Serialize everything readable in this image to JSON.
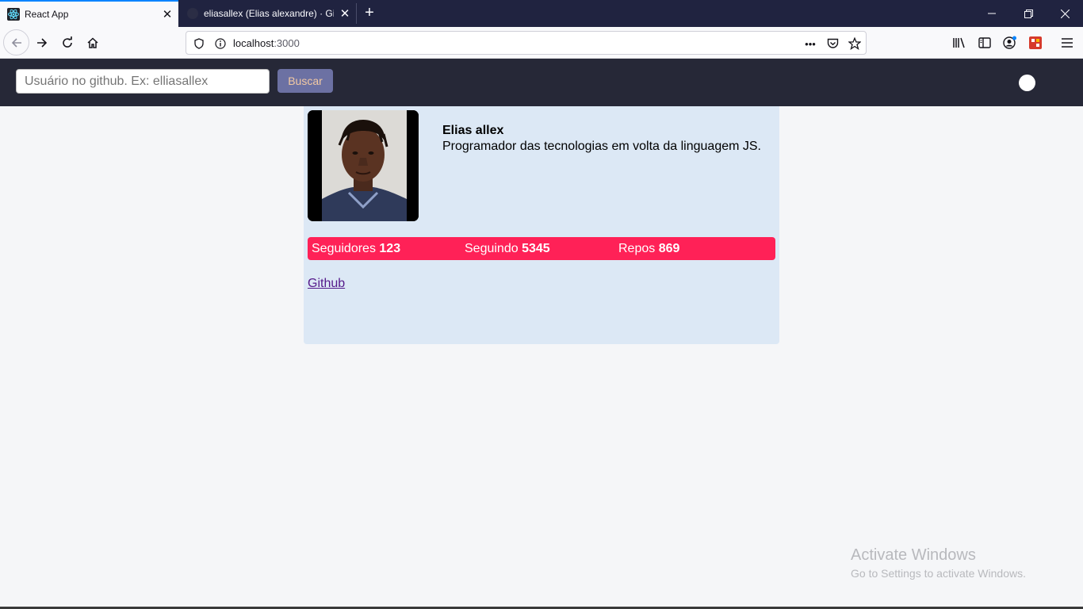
{
  "browser": {
    "tabs": [
      {
        "title": "React App",
        "active": true,
        "icon": "react-icon"
      },
      {
        "title": "eliasallex (Elias alexandre) · GitHub",
        "active": false,
        "icon": "github-icon"
      }
    ],
    "url_host": "localhost",
    "url_port": ":3000"
  },
  "search": {
    "placeholder": "Usuário no github. Ex: elliasallex",
    "value": "",
    "button_label": "Buscar"
  },
  "profile": {
    "name": "Elias allex",
    "bio": "Programador das tecnologias em volta da linguagem JS.",
    "stats": [
      {
        "label": "Seguidores",
        "value": "123"
      },
      {
        "label": "Seguindo",
        "value": "5345"
      },
      {
        "label": "Repos",
        "value": "869"
      }
    ],
    "link_label": "Github"
  },
  "watermark": {
    "line1": "Activate Windows",
    "line2": "Go to Settings to activate Windows."
  },
  "colors": {
    "header_bg": "#262837",
    "card_bg": "#dce8f5",
    "stats_bg": "#ff2157",
    "button_bg": "#6c71a3"
  }
}
